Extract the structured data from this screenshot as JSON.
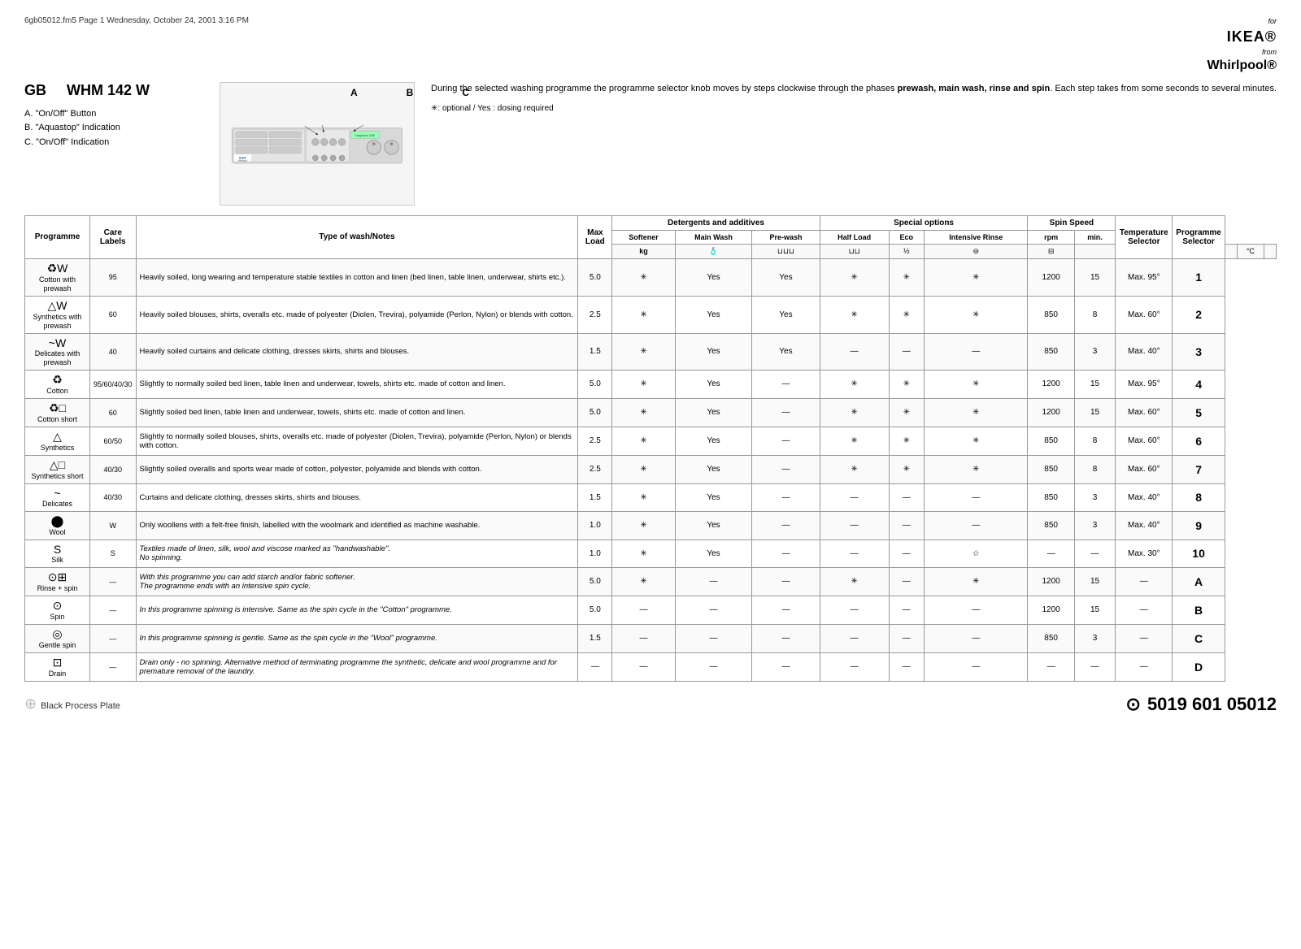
{
  "file_info": "6gb05012.fm5  Page 1  Wednesday, October 24, 2001  3:16 PM",
  "brand": {
    "for_text": "for",
    "ikea": "IKEA®",
    "from_text": "from",
    "whirlpool": "Whirlpool®"
  },
  "model": {
    "prefix": "GB",
    "name": "WHM 142 W"
  },
  "legend": {
    "a": "A.  \"On/Off\" Button",
    "b": "B.  \"Aquastop\" Indication",
    "c": "C.  \"On/Off\" Indication"
  },
  "right_description": "During the selected washing programme the programme selector knob moves by steps clockwise through the phases prewash, main wash, rinse and spin. Each step takes from some seconds to several minutes.",
  "optional_note": "✳: optional / Yes : dosing required",
  "table_headers": {
    "programme": "Programme",
    "care_labels": "Care Labels",
    "type_of_wash": "Type of wash/Notes",
    "max_load": "Max Load",
    "detergents": "Detergents and additives",
    "softener": "Softener",
    "main_wash": "Main Wash",
    "pre_wash": "Pre-wash",
    "special_options": "Special options",
    "half_load": "Half Load",
    "eco": "Eco",
    "intensive_rinse": "Intensive Rinse",
    "spin_speed": "Spin Speed",
    "rpm": "rpm",
    "min": "min.",
    "temperature": "Temperature Selector",
    "programme_selector": "Programme Selector",
    "units_kg": "kg",
    "units_temp": "°C"
  },
  "rows": [
    {
      "icon": "♻︎W",
      "programme": "Cotton with prewash",
      "care": "95",
      "notes": "Heavily soiled, long wearing and temperature stable textiles in cotton and linen (bed linen, table linen, underwear, shirts etc.).",
      "max_load": "5.0",
      "softener": "✳",
      "main_wash": "Yes",
      "pre_wash": "Yes",
      "half_load": "✳",
      "eco": "✳",
      "intensive_rinse": "✳",
      "rpm": "1200",
      "min": "15",
      "temp": "Max. 95°",
      "prog_sel": "1",
      "prog_bold": true
    },
    {
      "icon": "△W",
      "programme": "Synthetics with prewash",
      "care": "60",
      "notes": "Heavily soiled blouses, shirts, overalls etc. made of polyester (Diolen, Trevira), polyamide (Perlon, Nylon) or blends with cotton.",
      "max_load": "2.5",
      "softener": "✳",
      "main_wash": "Yes",
      "pre_wash": "Yes",
      "half_load": "✳",
      "eco": "✳",
      "intensive_rinse": "✳",
      "rpm": "850",
      "min": "8",
      "temp": "Max. 60°",
      "prog_sel": "2",
      "prog_bold": true
    },
    {
      "icon": "~W",
      "programme": "Delicates with prewash",
      "care": "40",
      "notes": "Heavily soiled curtains and delicate clothing, dresses skirts, shirts and blouses.",
      "max_load": "1.5",
      "softener": "✳",
      "main_wash": "Yes",
      "pre_wash": "Yes",
      "half_load": "—",
      "eco": "—",
      "intensive_rinse": "—",
      "rpm": "850",
      "min": "3",
      "temp": "Max. 40°",
      "prog_sel": "3",
      "prog_bold": true
    },
    {
      "icon": "♻︎",
      "programme": "Cotton",
      "care": "95/60/40/30",
      "notes": "Slightly to normally soiled bed linen, table linen and underwear, towels, shirts etc. made of cotton and linen.",
      "max_load": "5.0",
      "softener": "✳",
      "main_wash": "Yes",
      "pre_wash": "—",
      "half_load": "✳",
      "eco": "✳",
      "intensive_rinse": "✳",
      "rpm": "1200",
      "min": "15",
      "temp": "Max. 95°",
      "prog_sel": "4",
      "prog_bold": true
    },
    {
      "icon": "♻︎□",
      "programme": "Cotton short",
      "care": "60",
      "notes": "Slightly soiled bed linen, table linen and underwear, towels, shirts etc. made of cotton and linen.",
      "max_load": "5.0",
      "softener": "✳",
      "main_wash": "Yes",
      "pre_wash": "—",
      "half_load": "✳",
      "eco": "✳",
      "intensive_rinse": "✳",
      "rpm": "1200",
      "min": "15",
      "temp": "Max. 60°",
      "prog_sel": "5",
      "prog_bold": true
    },
    {
      "icon": "△",
      "programme": "Synthetics",
      "care": "60/50",
      "notes": "Slightly to normally soiled blouses, shirts, overalls etc. made of polyester (Diolen, Trevira), polyamide (Perlon, Nylon) or blends with cotton.",
      "max_load": "2.5",
      "softener": "✳",
      "main_wash": "Yes",
      "pre_wash": "—",
      "half_load": "✳",
      "eco": "✳",
      "intensive_rinse": "✳",
      "rpm": "850",
      "min": "8",
      "temp": "Max. 60°",
      "prog_sel": "6",
      "prog_bold": true
    },
    {
      "icon": "△□",
      "programme": "Synthetics short",
      "care": "40/30",
      "notes": "Slightly soiled overalls and sports wear made of cotton, polyester, polyamide and blends with cotton.",
      "max_load": "2.5",
      "softener": "✳",
      "main_wash": "Yes",
      "pre_wash": "—",
      "half_load": "✳",
      "eco": "✳",
      "intensive_rinse": "✳",
      "rpm": "850",
      "min": "8",
      "temp": "Max. 60°",
      "prog_sel": "7",
      "prog_bold": true
    },
    {
      "icon": "~",
      "programme": "Delicates",
      "care": "40/30",
      "notes": "Curtains and delicate clothing, dresses skirts, shirts and blouses.",
      "max_load": "1.5",
      "softener": "✳",
      "main_wash": "Yes",
      "pre_wash": "—",
      "half_load": "—",
      "eco": "—",
      "intensive_rinse": "—",
      "rpm": "850",
      "min": "3",
      "temp": "Max. 40°",
      "prog_sel": "8",
      "prog_bold": true
    },
    {
      "icon": "⬤",
      "programme": "Wool",
      "care": "W",
      "notes": "Only woollens with a felt-free finish, labelled with the woolmark and identified as machine washable.",
      "max_load": "1.0",
      "softener": "✳",
      "main_wash": "Yes",
      "pre_wash": "—",
      "half_load": "—",
      "eco": "—",
      "intensive_rinse": "—",
      "rpm": "850",
      "min": "3",
      "temp": "Max. 40°",
      "prog_sel": "9",
      "prog_bold": true
    },
    {
      "icon": "S",
      "programme": "Silk",
      "care": "S",
      "notes": "Textiles made of linen, silk, wool and viscose marked as \"handwashable\".\nNo spinning.",
      "notes_italic": true,
      "max_load": "1.0",
      "softener": "✳",
      "main_wash": "Yes",
      "pre_wash": "—",
      "half_load": "—",
      "eco": "—",
      "intensive_rinse": "☆",
      "rpm": "—",
      "min": "—",
      "temp": "Max. 30°",
      "prog_sel": "10",
      "prog_bold": true
    },
    {
      "icon": "⊙⊞",
      "programme": "Rinse + spin",
      "care": "—",
      "notes": "With this programme you can add starch and/or fabric softener.\nThe programme ends with an intensive spin cycle.",
      "notes_italic": true,
      "max_load": "5.0",
      "softener": "✳",
      "main_wash": "—",
      "pre_wash": "—",
      "half_load": "✳",
      "eco": "—",
      "intensive_rinse": "✳",
      "rpm": "1200",
      "min": "15",
      "temp": "—",
      "prog_sel": "A",
      "prog_bold": true
    },
    {
      "icon": "⊙",
      "programme": "Spin",
      "care": "—",
      "notes": "In this programme spinning is intensive. Same as the spin cycle in the \"Cotton\" programme.",
      "notes_italic": true,
      "max_load": "5.0",
      "softener": "—",
      "main_wash": "—",
      "pre_wash": "—",
      "half_load": "—",
      "eco": "—",
      "intensive_rinse": "—",
      "rpm": "1200",
      "min": "15",
      "temp": "—",
      "prog_sel": "B",
      "prog_bold": true
    },
    {
      "icon": "◎",
      "programme": "Gentle spin",
      "care": "—",
      "notes": "In this programme spinning is gentle. Same as the spin cycle in the \"Wool\" programme.",
      "notes_italic": true,
      "max_load": "1.5",
      "softener": "—",
      "main_wash": "—",
      "pre_wash": "—",
      "half_load": "—",
      "eco": "—",
      "intensive_rinse": "—",
      "rpm": "850",
      "min": "3",
      "temp": "—",
      "prog_sel": "C",
      "prog_bold": true
    },
    {
      "icon": "⊡",
      "programme": "Drain",
      "care": "—",
      "notes": "Drain only - no spinning. Alternative method of terminating programme the synthetic, delicate and wool programme and for premature removal of the laundry.",
      "notes_italic": true,
      "max_load": "—",
      "softener": "—",
      "main_wash": "—",
      "pre_wash": "—",
      "half_load": "—",
      "eco": "—",
      "intensive_rinse": "—",
      "rpm": "—",
      "min": "—",
      "temp": "—",
      "prog_sel": "D",
      "prog_bold": true
    }
  ],
  "footer": {
    "product_code": "5019 601 05012",
    "black_process": "Black Process Plate"
  }
}
